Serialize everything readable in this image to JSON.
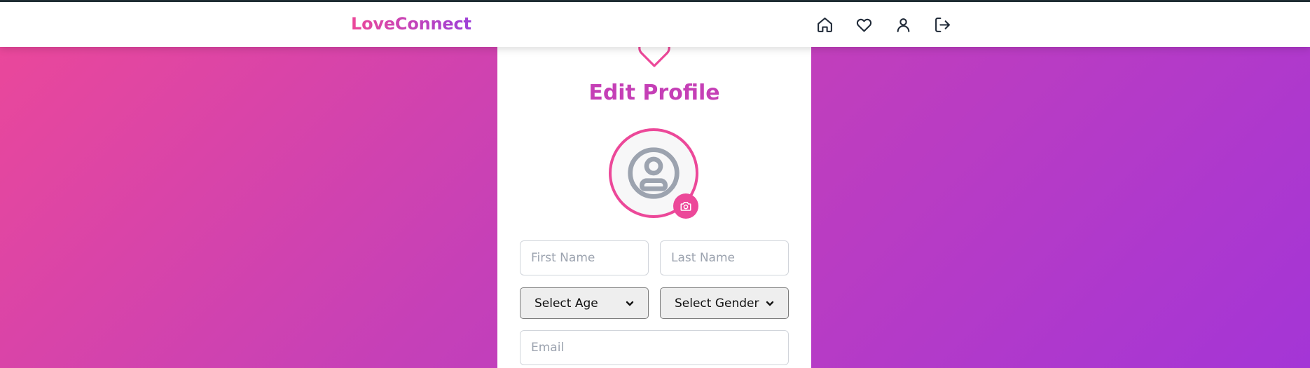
{
  "header": {
    "brand": "LoveConnect",
    "icons": [
      "home-icon",
      "heart-icon",
      "user-icon",
      "logout-icon"
    ]
  },
  "colors": {
    "accent": "#ec4899",
    "title": "#c53fb6",
    "gradient_start": "#ec4899",
    "gradient_end": "#a435d6"
  },
  "form": {
    "title": "Edit Profile",
    "avatar_icon": "user-circle-icon",
    "camera_icon": "camera-icon",
    "first_name_placeholder": "First Name",
    "last_name_placeholder": "Last Name",
    "age_select": "Select Age",
    "gender_select": "Select Gender",
    "email_placeholder": "Email"
  }
}
